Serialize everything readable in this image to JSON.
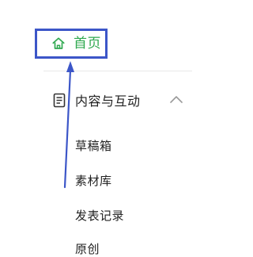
{
  "sidebar": {
    "home": {
      "label": "首页",
      "icon": "home-icon",
      "active_color": "#2fa84f"
    },
    "group": {
      "label": "内容与互动",
      "icon": "document-icon",
      "expand_icon": "chevron-up-icon",
      "items": [
        {
          "label": "草稿箱"
        },
        {
          "label": "素材库"
        },
        {
          "label": "发表记录"
        },
        {
          "label": "原创"
        }
      ]
    }
  },
  "annotation": {
    "color": "#3c56c8"
  }
}
